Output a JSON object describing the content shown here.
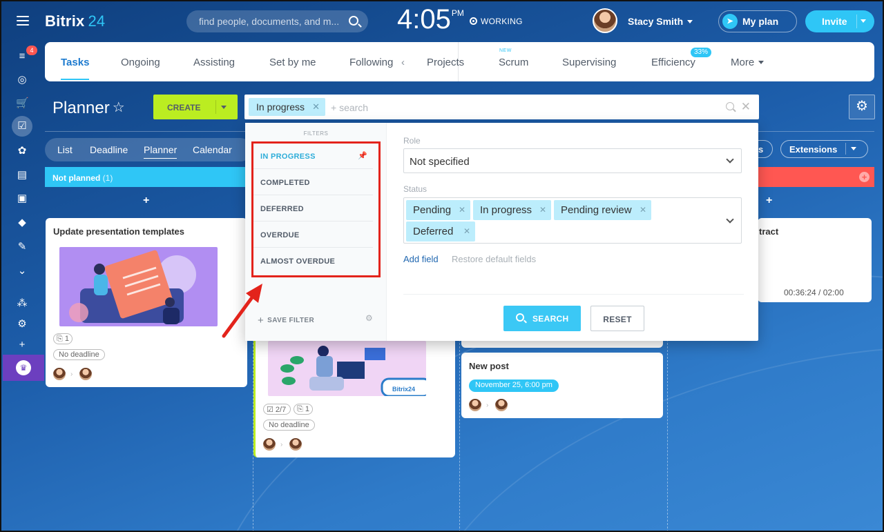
{
  "app": {
    "logo_main": "Bitrix",
    "logo_num": "24"
  },
  "header": {
    "search_placeholder": "find people, documents, and m...",
    "clock": "4:05",
    "clock_ampm": "PM",
    "working_label": "WORKING",
    "user_name": "Stacy Smith",
    "myplan_label": "My plan",
    "invite_label": "Invite"
  },
  "rail": {
    "notif_count": "4"
  },
  "tabs": {
    "items": [
      "Tasks",
      "Ongoing",
      "Assisting",
      "Set by me",
      "Following",
      "Projects",
      "Scrum",
      "Supervising",
      "Efficiency",
      "More"
    ],
    "new_tag": "NEW",
    "efficiency_pct": "33%"
  },
  "planner": {
    "title": "Planner",
    "create_label": "CREATE",
    "filter_chip": "In progress",
    "search_placeholder": "+ search",
    "views": [
      "List",
      "Deadline",
      "Planner",
      "Calendar"
    ],
    "extensions_label": "Extensions"
  },
  "columns": {
    "not_planned": {
      "label": "Not planned",
      "count": "(1)"
    }
  },
  "cards": {
    "c1": {
      "title": "Update presentation templates",
      "files": "1",
      "deadline": "No deadline"
    },
    "c2": {
      "checklist": "2/7",
      "files": "1",
      "deadline": "No deadline",
      "brand": "Bitrix24"
    },
    "c3": {
      "title": "New post",
      "date": "November 25, 6:00 pm"
    },
    "c4": {
      "title_partial": "tract",
      "timer": "00:36:24 / 02:00"
    }
  },
  "filter_popup": {
    "filters_heading": "FILTERS",
    "presets": [
      "IN PROGRESS",
      "COMPLETED",
      "DEFERRED",
      "OVERDUE",
      "ALMOST OVERDUE"
    ],
    "save_filter": "SAVE FILTER",
    "role_label": "Role",
    "role_value": "Not specified",
    "status_label": "Status",
    "status_tags": [
      "Pending",
      "In progress",
      "Pending review",
      "Deferred"
    ],
    "add_field": "Add field",
    "restore_fields": "Restore default fields",
    "search_btn": "SEARCH",
    "reset_btn": "RESET"
  },
  "colors": {
    "accent": "#2fc6f6",
    "create": "#bbed21",
    "highlight": "#e3231b"
  }
}
